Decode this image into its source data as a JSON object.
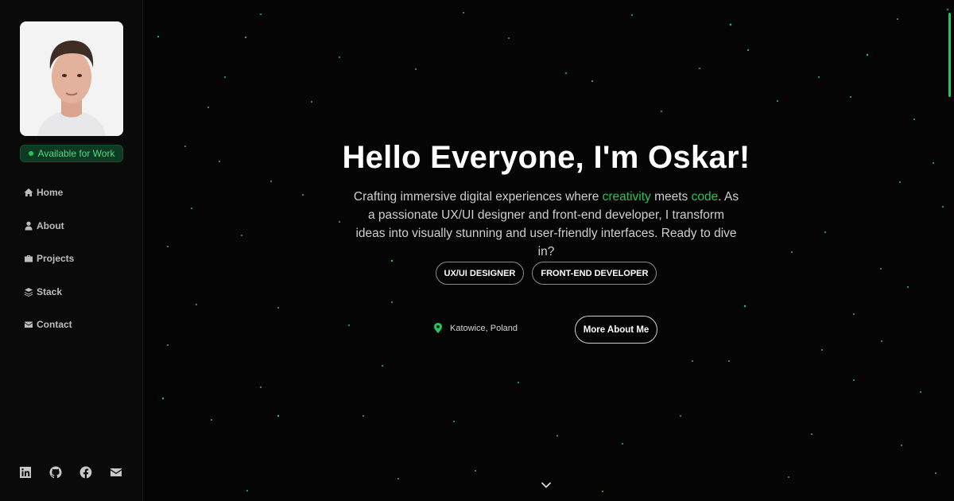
{
  "sidebar": {
    "status": "Available for Work",
    "nav": [
      {
        "label": "Home",
        "icon": "home-icon"
      },
      {
        "label": "About",
        "icon": "user-icon"
      },
      {
        "label": "Projects",
        "icon": "briefcase-icon"
      },
      {
        "label": "Stack",
        "icon": "layers-icon"
      },
      {
        "label": "Contact",
        "icon": "envelope-icon"
      }
    ],
    "socials": [
      "linkedin-icon",
      "github-icon",
      "facebook-icon",
      "email-icon"
    ]
  },
  "hero": {
    "title": "Hello Everyone, I'm Oskar!",
    "desc_part1": "Crafting immersive digital experiences where ",
    "desc_highlight1": "creativity",
    "desc_part2": " meets ",
    "desc_highlight2": "code",
    "desc_part3": ". As a passionate UX/UI designer and front-end developer, I transform ideas into visually stunning and user-friendly interfaces. Ready to dive in?",
    "tags": [
      "UX/UI DESIGNER",
      "FRONT-END DEVELOPER"
    ],
    "location": "Katowice, Poland",
    "cta": "More About Me"
  },
  "colors": {
    "accent": "#22c55e",
    "background": "#050505",
    "sidebar": "#0a0a0a"
  }
}
